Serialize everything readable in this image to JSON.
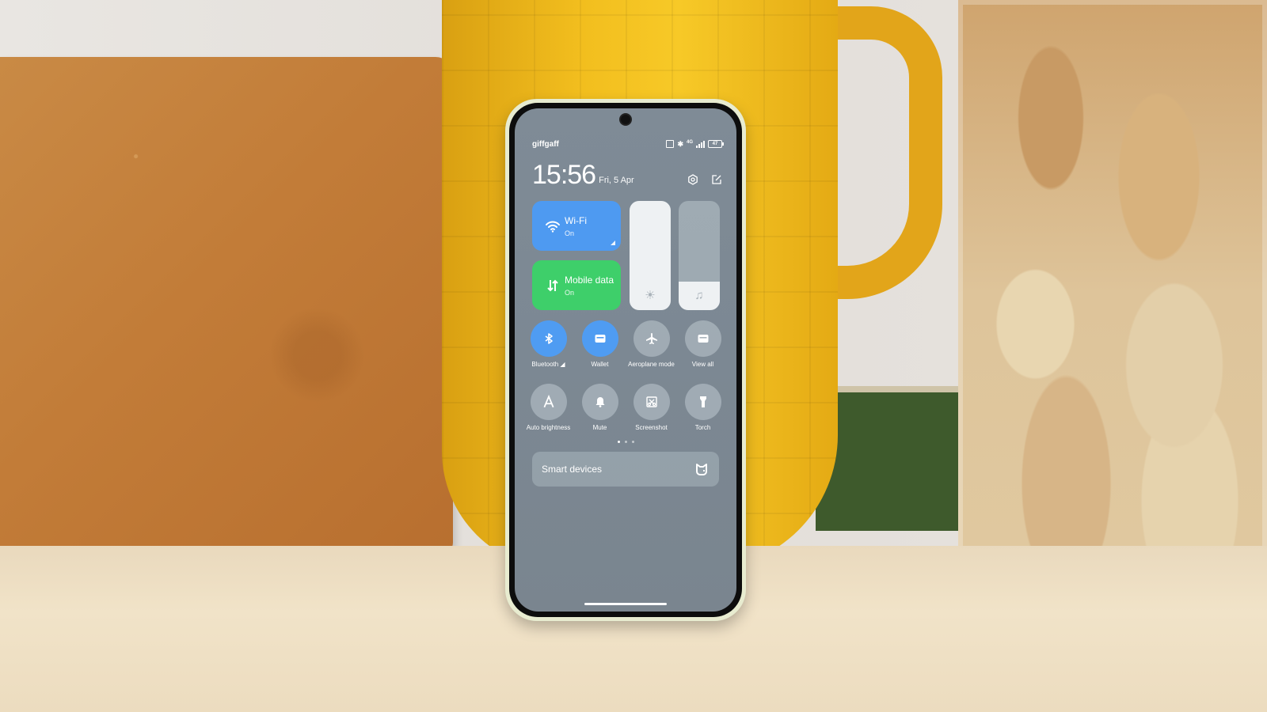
{
  "status_bar": {
    "carrier": "giffgaff",
    "network": "4G",
    "battery": "47",
    "icons": [
      "nfc-icon",
      "bluetooth-icon",
      "signal-icon",
      "battery-icon"
    ]
  },
  "header": {
    "time": "15:56",
    "date": "Fri, 5 Apr",
    "icons": [
      "settings-icon",
      "edit-icon"
    ]
  },
  "tiles": {
    "wifi": {
      "title": "Wi-Fi",
      "state": "On",
      "icon": "wifi-icon",
      "color": "#4e9af1"
    },
    "mobile_data": {
      "title": "Mobile data",
      "state": "On",
      "icon": "data-arrows-icon",
      "color": "#3ecf6a"
    }
  },
  "sliders": {
    "brightness": {
      "icon": "sun-icon",
      "level_percent": 100
    },
    "volume": {
      "icon": "music-note-icon",
      "level_percent": 26
    }
  },
  "toggles": [
    {
      "label": "Bluetooth ◢",
      "icon": "bluetooth-icon",
      "on": true
    },
    {
      "label": "Wallet",
      "icon": "wallet-icon",
      "on": true
    },
    {
      "label": "Aeroplane mode",
      "icon": "airplane-icon",
      "on": false
    },
    {
      "label": "View all",
      "icon": "wallet-icon",
      "on": false
    },
    {
      "label": "Auto brightness",
      "icon": "letter-a-icon",
      "on": false
    },
    {
      "label": "Mute",
      "icon": "bell-icon",
      "on": false
    },
    {
      "label": "Screenshot",
      "icon": "scissors-icon",
      "on": false
    },
    {
      "label": "Torch",
      "icon": "flashlight-icon",
      "on": false
    }
  ],
  "pagination": {
    "pages": 3,
    "active": 1
  },
  "smart_devices": {
    "label": "Smart devices",
    "icon": "mi-home-icon"
  },
  "colors": {
    "accent_blue": "#4e9af1",
    "accent_green": "#3ecf6a",
    "panel_bg": "#7f8b96"
  }
}
